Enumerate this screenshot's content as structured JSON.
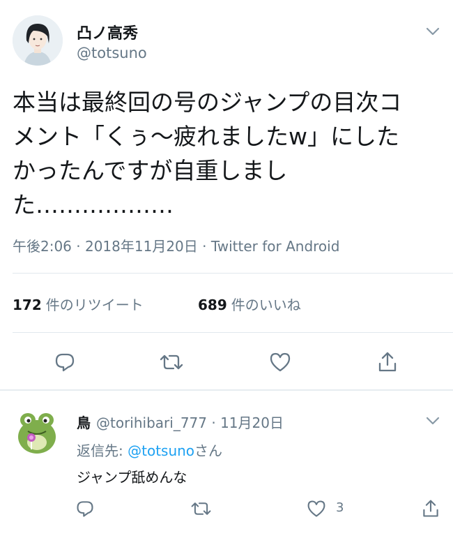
{
  "tweet": {
    "display_name": "凸ノ高秀",
    "handle": "@totsuno",
    "text": "本当は最終回の号のジャンプの目次コ\nメント「くぅ〜疲れましたw」にした\nかったんですが自重しまし\nた………………",
    "meta": "午後2:06 · 2018年11月20日 · Twitter for Android",
    "retweets_count": "172",
    "retweets_label": "件のリツイート",
    "likes_count": "689",
    "likes_label": "件のいいね",
    "icons": [
      "reply-icon",
      "retweet-icon",
      "like-icon",
      "share-icon"
    ]
  },
  "reply": {
    "display_name": "鳥",
    "handle": "@torihibari_777",
    "date": "· 11月20日",
    "to_prefix": "返信先: ",
    "to_mention": "@totsuno",
    "to_suffix": "さん",
    "text": "ジャンプ舐めんな",
    "like_count": "3",
    "icons": [
      "reply-icon",
      "retweet-icon",
      "like-icon",
      "share-icon"
    ]
  },
  "colors": {
    "text": "#14171a",
    "secondary": "#657786",
    "link": "#1da1f2",
    "divider": "#e1e8ed"
  }
}
